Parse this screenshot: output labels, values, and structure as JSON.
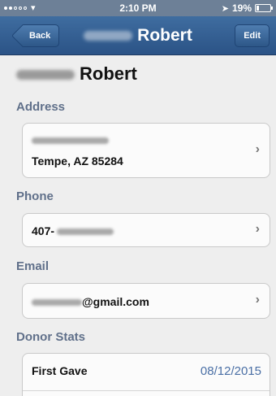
{
  "status_bar": {
    "time": "2:10 PM",
    "battery": "19%",
    "battery_fraction": 0.19
  },
  "nav": {
    "back_label": "Back",
    "title": "Robert",
    "edit_label": "Edit"
  },
  "contact": {
    "name": "Robert"
  },
  "address": {
    "section_title": "Address",
    "line2": "Tempe, AZ 85284"
  },
  "phone": {
    "section_title": "Phone",
    "prefix": "407-"
  },
  "email": {
    "section_title": "Email",
    "suffix": "@gmail.com"
  },
  "donor_stats": {
    "section_title": "Donor Stats",
    "first_gave_label": "First Gave",
    "first_gave_value": "08/12/2015"
  },
  "icons": {
    "chevron": "chevron-right-icon",
    "wifi": "wifi-icon",
    "location": "location-arrow-icon",
    "battery": "battery-icon"
  },
  "colors": {
    "nav": "#2b5386",
    "section_title": "#60708a",
    "stat_value": "#4a6fa5",
    "background": "#eeeeee"
  }
}
